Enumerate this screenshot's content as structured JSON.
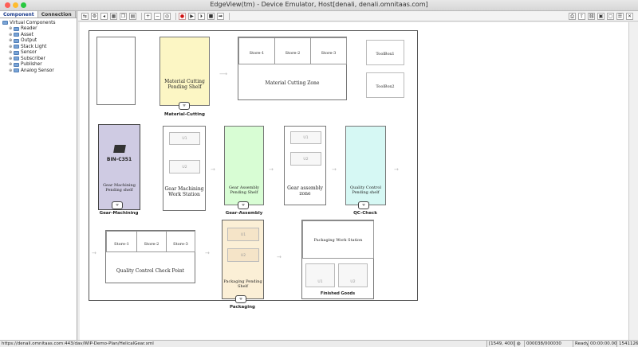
{
  "window": {
    "title": "EdgeView(tm) - Device Emulator, Host[denali, denali.omnitaas.com]"
  },
  "left_panel": {
    "tabs": [
      "Component",
      "Connection"
    ],
    "tree_root": "Virtual Components",
    "tree_items": [
      "Reader",
      "Asset",
      "Output",
      "Stack Light",
      "Sensor",
      "Subscriber",
      "Publisher",
      "Analog Sensor"
    ]
  },
  "canvas": {
    "material_cutting": {
      "shelf_label": "Material Cutting Pending Shelf",
      "caption": "Material-Cutting"
    },
    "cutting_zone": {
      "stores": [
        "Store-1",
        "Store-2",
        "Store-3"
      ],
      "zone_label": "Material Cutting Zone"
    },
    "toolboxes": [
      "ToolBox1",
      "ToolBox2"
    ],
    "gear_machining": {
      "bin_label": "BIN-C351",
      "shelf_label": "Gear Machining Pending shelf",
      "caption": "Gear-Machining"
    },
    "gear_machining_ws": {
      "cells": [
        "U1",
        "U2"
      ],
      "label": "Gear Machining Work Station"
    },
    "gear_assembly": {
      "shelf_label": "Gear Assembly Pending Shelf",
      "caption": "Gear-Assembly"
    },
    "gear_assembly_zone": {
      "cells": [
        "U1",
        "U2"
      ],
      "label": "Gear assembly zone"
    },
    "qc": {
      "shelf_label": "Quality Control Pending shelf",
      "caption": "QC-Check"
    },
    "qc_checkpoint": {
      "stores": [
        "Store-1",
        "Store-2",
        "Store-3"
      ],
      "label": "Quality Control Check Point"
    },
    "packaging": {
      "cells": [
        "U1",
        "U2"
      ],
      "shelf_label": "Packaging Pending Shelf",
      "caption": "Packaging"
    },
    "packaging_ws": {
      "title": "Packaging Work Station",
      "cells": [
        "U1",
        "U2"
      ],
      "goods_label": "Finished Goods"
    }
  },
  "status": {
    "url": "https://denali.omnitaas.com:443/dav/WIP-Demo-Plan/HelicalGear.xml",
    "coords": "[1549, 400]",
    "counter": "000038/000030",
    "state": "Ready",
    "time": "00:00:00.00",
    "memory": "1541126"
  }
}
